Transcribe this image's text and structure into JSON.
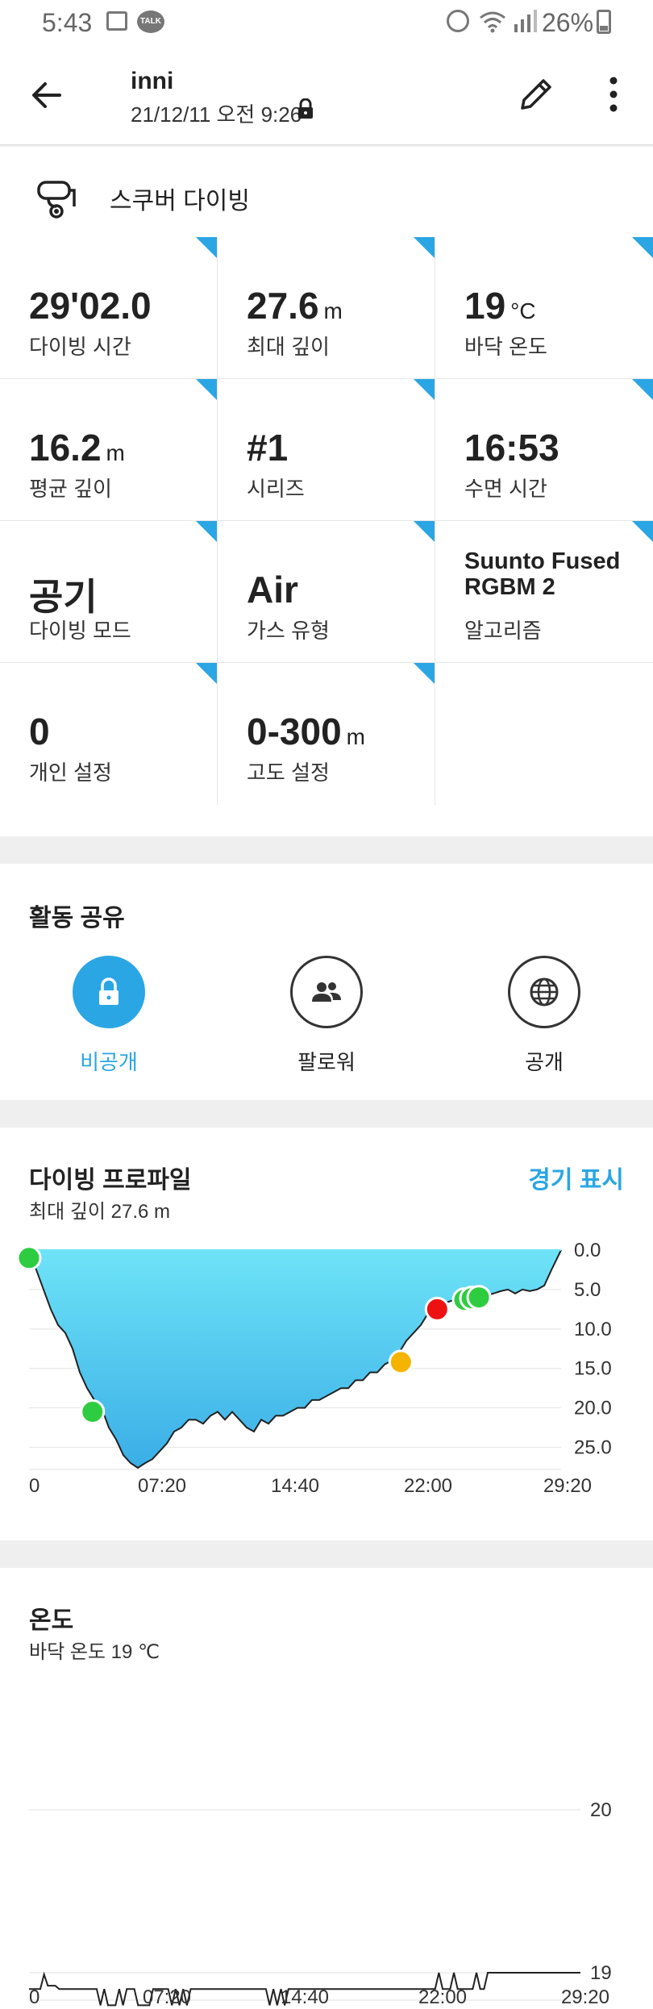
{
  "status_bar": {
    "time": "5:43",
    "talk": "TALK",
    "battery": "26%"
  },
  "header": {
    "title": "inni",
    "subtitle": "21/12/11 오전 9:26"
  },
  "activity": {
    "name": "스쿠버 다이빙",
    "stats": [
      {
        "value": "29'02.0",
        "unit": "",
        "label": "다이빙 시간"
      },
      {
        "value": "27.6",
        "unit": "m",
        "label": "최대 깊이"
      },
      {
        "value": "19",
        "unit": "°C",
        "label": "바닥 온도"
      },
      {
        "value": "16.2",
        "unit": "m",
        "label": "평균 깊이"
      },
      {
        "value": "#1",
        "unit": "",
        "label": "시리즈"
      },
      {
        "value": "16:53",
        "unit": "",
        "label": "수면 시간"
      },
      {
        "value": "공기",
        "unit": "",
        "label": "다이빙 모드"
      },
      {
        "value": "Air",
        "unit": "",
        "label": "가스 유형"
      },
      {
        "value": "Suunto Fused RGBM 2",
        "unit": "",
        "label": "알고리즘"
      },
      {
        "value": "0",
        "unit": "",
        "label": "개인 설정"
      },
      {
        "value": "0-300",
        "unit": "m",
        "label": "고도 설정"
      }
    ]
  },
  "share": {
    "title": "활동 공유",
    "options": [
      {
        "label": "비공개",
        "icon": "lock-icon",
        "active": true
      },
      {
        "label": "팔로워",
        "icon": "followers-icon",
        "active": false
      },
      {
        "label": "공개",
        "icon": "globe-icon",
        "active": false
      }
    ]
  },
  "profile": {
    "title": "다이빙 프로파일",
    "subtitle": "최대 깊이 27.6 m",
    "link": "경기 표시"
  },
  "temperature": {
    "title": "온도",
    "subtitle": "바닥 온도 19 ℃"
  },
  "colors": {
    "accent": "#2aa6e4",
    "event_green": "#2ecc40",
    "event_red": "#ee1111",
    "event_orange": "#f5b400"
  },
  "chart_data": [
    {
      "type": "area",
      "x_tick_labels": [
        "0",
        "07:20",
        "14:40",
        "22:00",
        "29:20"
      ],
      "y_tick_labels": [
        "0.0",
        "5.0",
        "10.0",
        "15.0",
        "20.0",
        "25.0"
      ],
      "xlim": [
        0,
        29.33
      ],
      "ylim": [
        0,
        27.6
      ],
      "y_inverted": true,
      "series": [
        {
          "x": [
            0,
            0.4,
            0.8,
            1.2,
            1.6,
            2.0,
            2.4,
            2.8,
            3.2,
            3.6,
            4.0,
            4.4,
            4.8,
            5.2,
            5.6,
            6.0,
            6.4,
            6.8,
            7.2,
            7.6,
            8.0,
            8.4,
            8.8,
            9.2,
            9.6,
            10.0,
            10.4,
            10.8,
            11.2,
            11.6,
            12.0,
            12.4,
            12.8,
            13.2,
            13.6,
            14.0,
            14.4,
            14.8,
            15.2,
            15.6,
            16.0,
            16.4,
            16.8,
            17.2,
            17.6,
            18.0,
            18.4,
            18.8,
            19.2,
            19.6,
            20.0,
            20.4,
            20.8,
            21.2,
            21.6,
            22.0,
            22.4,
            22.8,
            23.2,
            23.6,
            24.0,
            24.4,
            24.8,
            25.2,
            25.6,
            26.0,
            26.4,
            26.8,
            27.2,
            27.6,
            28.0,
            28.4,
            28.8,
            29.33
          ],
          "y": [
            0.5,
            2.5,
            5.0,
            7.5,
            9.5,
            10.5,
            12.5,
            15.5,
            17.5,
            19.0,
            20.0,
            22.5,
            24.0,
            26.0,
            27.0,
            27.6,
            27.0,
            26.5,
            25.5,
            24.5,
            23.0,
            22.5,
            21.5,
            21.5,
            22.0,
            21.0,
            20.5,
            21.5,
            20.5,
            21.5,
            22.5,
            23.0,
            21.5,
            22.0,
            21.0,
            21.0,
            20.5,
            20.0,
            20.0,
            19.0,
            19.0,
            18.5,
            18.0,
            17.5,
            17.5,
            16.5,
            16.5,
            15.5,
            15.5,
            14.5,
            14.0,
            13.0,
            11.5,
            10.5,
            9.5,
            8.0,
            7.5,
            6.8,
            6.5,
            6.2,
            6.0,
            5.8,
            5.5,
            5.8,
            5.5,
            5.2,
            5.0,
            5.5,
            5.0,
            5.2,
            5.0,
            4.5,
            2.5,
            0.0
          ]
        }
      ],
      "events": [
        {
          "x": 0.0,
          "y": 1.0,
          "color": "green"
        },
        {
          "x": 3.5,
          "y": 20.5,
          "color": "green"
        },
        {
          "x": 20.5,
          "y": 14.2,
          "color": "orange"
        },
        {
          "x": 22.5,
          "y": 7.5,
          "color": "red"
        },
        {
          "x": 24.0,
          "y": 6.3,
          "color": "green"
        },
        {
          "x": 24.4,
          "y": 6.1,
          "color": "green"
        },
        {
          "x": 24.8,
          "y": 6.0,
          "color": "green"
        }
      ]
    },
    {
      "type": "line",
      "x_tick_labels": [
        "0",
        "07:20",
        "14:40",
        "22:00",
        "29:20"
      ],
      "y_tick_labels": [
        "20",
        "19"
      ],
      "xlim": [
        0,
        29.33
      ],
      "ylim": [
        18.8,
        20.0
      ],
      "series": [
        {
          "x": [
            0,
            0.6,
            0.8,
            1.0,
            1.4,
            1.6,
            2.0,
            3.6,
            3.8,
            4.0,
            4.2,
            4.6,
            4.8,
            5.0,
            5.2,
            5.6,
            5.8,
            6.4,
            6.6,
            6.8,
            7.4,
            7.6,
            7.8,
            8.0,
            8.2,
            8.4,
            8.6,
            8.8,
            12.6,
            12.8,
            13.0,
            13.2,
            13.4,
            13.6,
            13.8,
            14.0,
            21.6,
            21.8,
            22.0,
            22.4,
            22.6,
            22.8,
            23.6,
            23.8,
            24.0,
            24.2,
            24.4,
            29.33
          ],
          "y": [
            18.9,
            18.9,
            18.99,
            18.92,
            18.92,
            18.9,
            18.9,
            18.9,
            18.8,
            18.9,
            18.8,
            18.8,
            18.9,
            18.8,
            18.9,
            18.9,
            18.8,
            18.8,
            18.9,
            18.9,
            18.9,
            18.8,
            18.9,
            18.8,
            18.9,
            18.8,
            18.9,
            18.9,
            18.9,
            18.8,
            18.9,
            18.8,
            18.9,
            18.8,
            18.9,
            18.9,
            18.9,
            19.0,
            18.9,
            18.9,
            19.0,
            18.9,
            18.9,
            19.0,
            18.9,
            18.9,
            19.0,
            19.0
          ]
        }
      ]
    }
  ]
}
